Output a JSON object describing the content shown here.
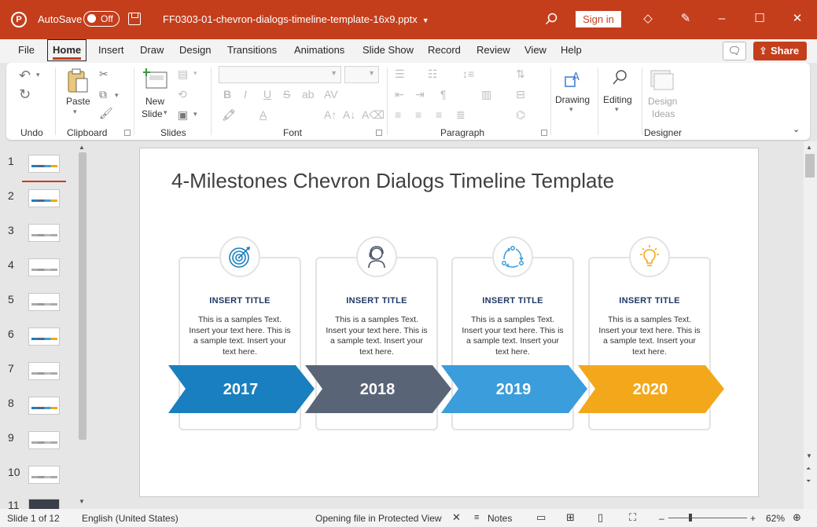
{
  "titlebar": {
    "autosave_label": "AutoSave",
    "autosave_state": "Off",
    "filename": "FF0303-01-chevron-dialogs-timeline-template-16x9.pptx",
    "signin": "Sign in",
    "brand_color": "#c43e1c"
  },
  "menu": {
    "tabs": [
      "File",
      "Home",
      "Insert",
      "Draw",
      "Design",
      "Transitions",
      "Animations",
      "Slide Show",
      "Record",
      "Review",
      "View",
      "Help"
    ],
    "active": "Home",
    "share": "Share"
  },
  "ribbon": {
    "groups": {
      "undo": "Undo",
      "clipboard": "Clipboard",
      "slides": "Slides",
      "font": "Font",
      "paragraph": "Paragraph",
      "designer": "Designer"
    },
    "paste": "Paste",
    "new_slide_line1": "New",
    "new_slide_line2": "Slide",
    "drawing": "Drawing",
    "editing": "Editing",
    "design_ideas_line1": "Design",
    "design_ideas_line2": "Ideas"
  },
  "thumbnails": [
    "1",
    "2",
    "3",
    "4",
    "5",
    "6",
    "7",
    "8",
    "9",
    "10",
    "11"
  ],
  "slide": {
    "title": "4-Milestones Chevron Dialogs Timeline Template",
    "milestones": [
      {
        "title": "INSERT TITLE",
        "body": "This is a samples Text. Insert your text here. This is a sample text. Insert your text here.",
        "year": "2017",
        "color": "#1a7fbf",
        "icon": "target-icon"
      },
      {
        "title": "INSERT TITLE",
        "body": "This is a samples Text. Insert your text here. This is a sample text. Insert your text here.",
        "year": "2018",
        "color": "#596577",
        "icon": "person-headset-icon"
      },
      {
        "title": "INSERT TITLE",
        "body": "This is a samples Text. Insert your text here. This is a sample text. Insert your text here.",
        "year": "2019",
        "color": "#3b9ddb",
        "icon": "cycle-icon"
      },
      {
        "title": "INSERT TITLE",
        "body": "This is a samples Text. Insert your text here. This is a sample text. Insert your text here.",
        "year": "2020",
        "color": "#f3a81c",
        "icon": "lightbulb-icon"
      }
    ]
  },
  "status": {
    "slide_info": "Slide 1 of 12",
    "language": "English (United States)",
    "protected": "Opening file in Protected View",
    "notes": "Notes",
    "zoom": "62%"
  }
}
